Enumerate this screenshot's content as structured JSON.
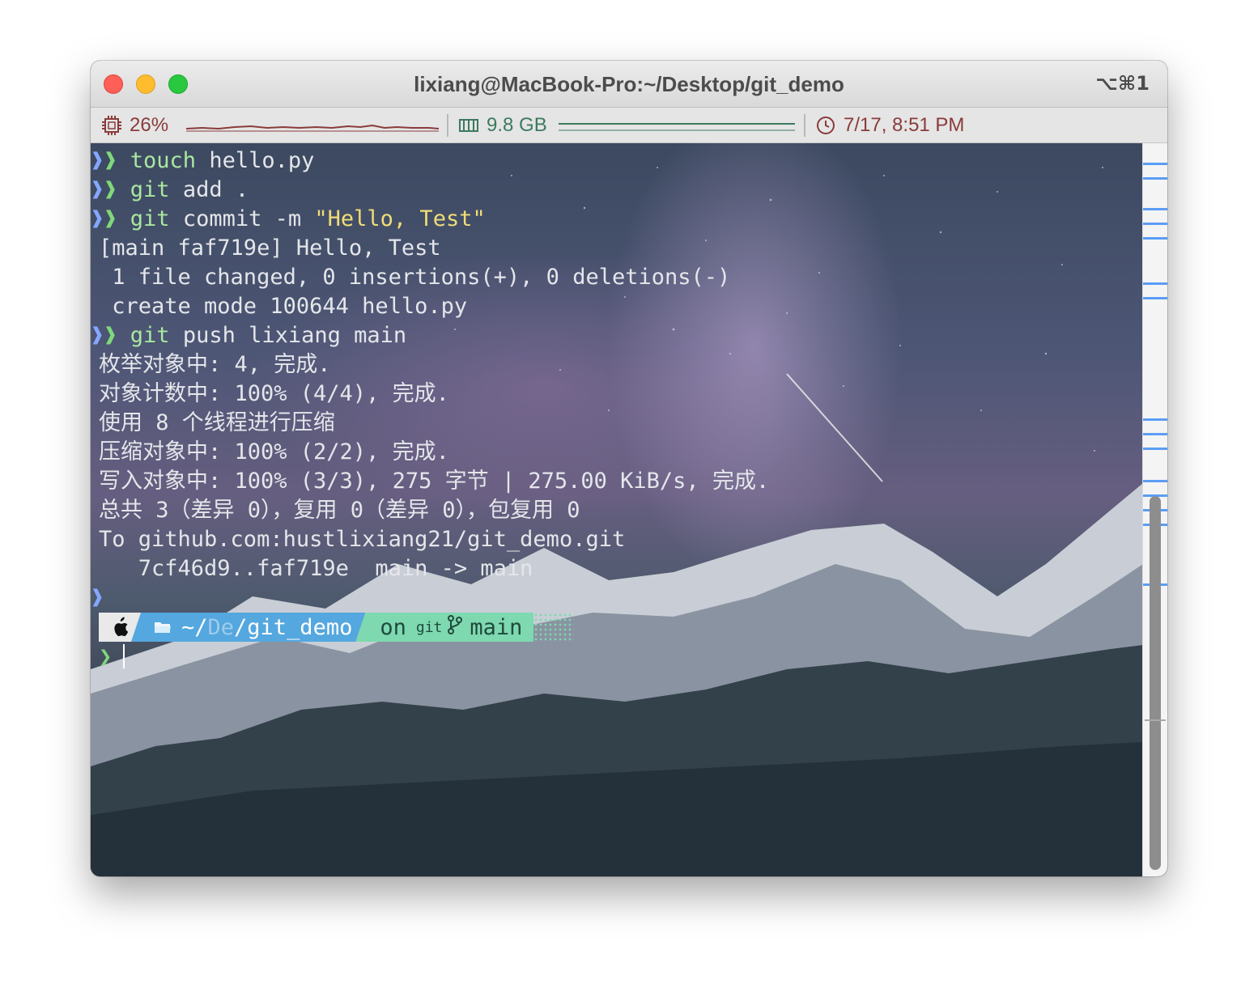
{
  "window": {
    "title": "lixiang@MacBook-Pro:~/Desktop/git_demo",
    "shortcut": "⌥⌘1"
  },
  "statusbar": {
    "cpu": {
      "icon": "cpu-chip-icon",
      "value": "26%",
      "color": "#8a3b3b"
    },
    "memory": {
      "icon": "memory-icon",
      "value": "9.8 GB",
      "color": "#3c7a5f"
    },
    "clock": {
      "icon": "clock-icon",
      "value": "7/17, 8:51 PM",
      "color": "#8a3b3b"
    }
  },
  "terminal": {
    "history": [
      {
        "type": "command",
        "cmd": "touch",
        "args": "hello.py",
        "str": ""
      },
      {
        "type": "command",
        "cmd": "git",
        "args": "add .",
        "str": ""
      },
      {
        "type": "command",
        "cmd": "git",
        "args": "commit -m ",
        "str": "\"Hello, Test\""
      },
      {
        "type": "output",
        "text": "[main faf719e] Hello, Test"
      },
      {
        "type": "output",
        "text": " 1 file changed, 0 insertions(+), 0 deletions(-)"
      },
      {
        "type": "output",
        "text": " create mode 100644 hello.py"
      },
      {
        "type": "command",
        "cmd": "git",
        "args": "push lixiang main",
        "str": ""
      },
      {
        "type": "output",
        "text": "枚举对象中: 4, 完成."
      },
      {
        "type": "output",
        "text": "对象计数中: 100% (4/4), 完成."
      },
      {
        "type": "output",
        "text": "使用 8 个线程进行压缩"
      },
      {
        "type": "output",
        "text": "压缩对象中: 100% (2/2), 完成."
      },
      {
        "type": "output",
        "text": "写入对象中: 100% (3/3), 275 字节 | 275.00 KiB/s, 完成."
      },
      {
        "type": "output",
        "text": "总共 3（差异 0），复用 0（差异 0），包复用 0"
      },
      {
        "type": "output",
        "text": "To github.com:hustlixiang21/git_demo.git"
      },
      {
        "type": "output",
        "text": "   7cf46d9..faf719e  main -> main"
      }
    ],
    "prompt": {
      "apple_icon": "apple-logo-icon",
      "folder_icon": "folder-icon",
      "path_home": "~/",
      "path_dim": "De",
      "path_rest": "/git_demo",
      "on_label": "on",
      "git_label": "git",
      "branch_icon": "git-branch-icon",
      "branch": "main"
    },
    "prompt_symbol": "❯"
  },
  "colors": {
    "prompt_arrow": "#7fd87a",
    "command": "#a9e7a0",
    "string": "#f0dd76",
    "dir_segment": "#54a7df",
    "git_segment": "#7ed8b0",
    "scroll_mark": "#5b9df5"
  }
}
